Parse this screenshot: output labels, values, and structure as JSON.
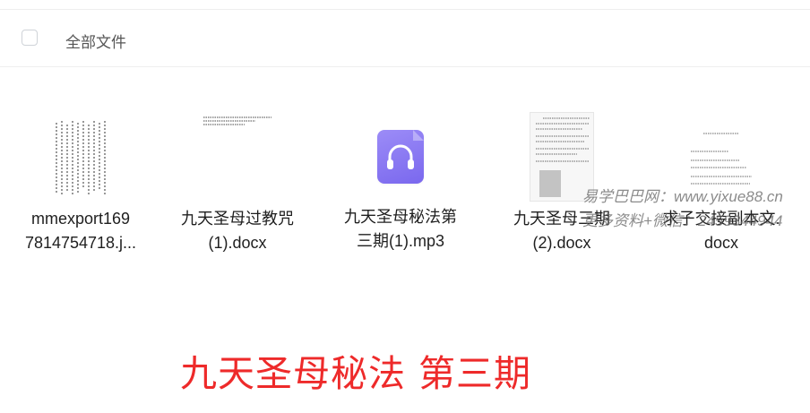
{
  "header": {
    "title": "全部文件"
  },
  "files": [
    {
      "name_line1": "mmexport169",
      "name_line2": "7814754718.j...",
      "type": "image-thumbnail"
    },
    {
      "name_line1": "九天圣母过教咒",
      "name_line2": "(1).docx",
      "type": "docx-thumbnail"
    },
    {
      "name_line1": "九天圣母秘法第",
      "name_line2": "三期(1).mp3",
      "type": "audio-icon"
    },
    {
      "name_line1": "九天圣母三期",
      "name_line2": "(2).docx",
      "type": "docx-thumbnail"
    },
    {
      "name_line1": "求子交接副本文.",
      "name_line2": "docx",
      "type": "docx-thumbnail"
    }
  ],
  "watermark": {
    "line1": "易学巴巴网：www.yixue88.cn",
    "line2": "更多资料+微信：2459344944"
  },
  "banner": {
    "title": "九天圣母秘法 第三期"
  },
  "colors": {
    "accent_red": "#ee2a2a",
    "audio_icon": "#8b7bf3"
  }
}
